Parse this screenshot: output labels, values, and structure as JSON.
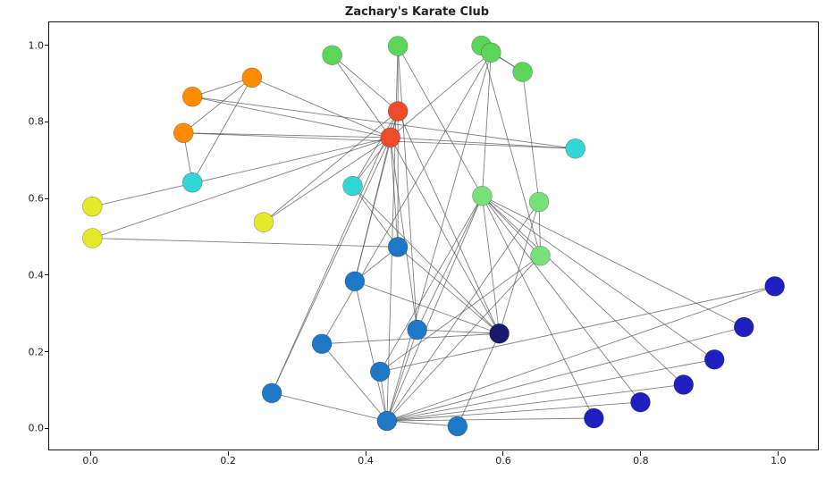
{
  "chart_data": {
    "type": "network",
    "title": "Zachary's Karate Club",
    "xlabel": "",
    "ylabel": "",
    "xlim": [
      -0.06,
      1.06
    ],
    "ylim": [
      -0.06,
      1.06
    ],
    "x_ticks": [
      0.0,
      0.2,
      0.4,
      0.6,
      0.8,
      1.0
    ],
    "y_ticks": [
      0.0,
      0.2,
      0.4,
      0.6,
      0.8,
      1.0
    ],
    "nodes": [
      {
        "id": 0,
        "x": 0.437,
        "y": 0.758,
        "color": "#ee4b2b"
      },
      {
        "id": 1,
        "x": 0.448,
        "y": 0.827,
        "color": "#ee4b2b"
      },
      {
        "id": 2,
        "x": 0.596,
        "y": 0.244,
        "color": "#191970"
      },
      {
        "id": 3,
        "x": 0.448,
        "y": 0.471,
        "color": "#1e78c8"
      },
      {
        "id": 4,
        "x": 0.148,
        "y": 0.865,
        "color": "#ff8c00"
      },
      {
        "id": 5,
        "x": 0.135,
        "y": 0.77,
        "color": "#ff8c00"
      },
      {
        "id": 6,
        "x": 0.235,
        "y": 0.915,
        "color": "#ff8c00"
      },
      {
        "id": 7,
        "x": 0.382,
        "y": 0.631,
        "color": "#33d6d6"
      },
      {
        "id": 8,
        "x": 0.476,
        "y": 0.254,
        "color": "#1e78c8"
      },
      {
        "id": 9,
        "x": 0.535,
        "y": 0.001,
        "color": "#1e78c8"
      },
      {
        "id": 10,
        "x": 0.707,
        "y": 0.729,
        "color": "#33d6d6"
      },
      {
        "id": 11,
        "x": 0.002,
        "y": 0.577,
        "color": "#e8e82a"
      },
      {
        "id": 12,
        "x": 0.002,
        "y": 0.494,
        "color": "#e8e82a"
      },
      {
        "id": 13,
        "x": 0.385,
        "y": 0.381,
        "color": "#1e78c8"
      },
      {
        "id": 14,
        "x": 0.734,
        "y": 0.022,
        "color": "#2020c0"
      },
      {
        "id": 15,
        "x": 0.802,
        "y": 0.064,
        "color": "#2020c0"
      },
      {
        "id": 16,
        "x": 0.148,
        "y": 0.64,
        "color": "#33d6d6"
      },
      {
        "id": 17,
        "x": 0.252,
        "y": 0.536,
        "color": "#e8e82a"
      },
      {
        "id": 18,
        "x": 0.865,
        "y": 0.11,
        "color": "#2020c0"
      },
      {
        "id": 19,
        "x": 0.264,
        "y": 0.088,
        "color": "#1e78c8"
      },
      {
        "id": 20,
        "x": 0.91,
        "y": 0.176,
        "color": "#2020c0"
      },
      {
        "id": 21,
        "x": 0.352,
        "y": 0.974,
        "color": "#5bd65b"
      },
      {
        "id": 22,
        "x": 0.953,
        "y": 0.261,
        "color": "#2020c0"
      },
      {
        "id": 23,
        "x": 0.656,
        "y": 0.448,
        "color": "#78e078"
      },
      {
        "id": 24,
        "x": 0.63,
        "y": 0.93,
        "color": "#5bd65b"
      },
      {
        "id": 25,
        "x": 0.57,
        "y": 0.999,
        "color": "#5bd65b"
      },
      {
        "id": 26,
        "x": 0.998,
        "y": 0.368,
        "color": "#2020c0"
      },
      {
        "id": 27,
        "x": 0.654,
        "y": 0.589,
        "color": "#78e078"
      },
      {
        "id": 28,
        "x": 0.337,
        "y": 0.217,
        "color": "#1e78c8"
      },
      {
        "id": 29,
        "x": 0.422,
        "y": 0.144,
        "color": "#1e78c8"
      },
      {
        "id": 30,
        "x": 0.448,
        "y": 0.998,
        "color": "#5bd65b"
      },
      {
        "id": 31,
        "x": 0.584,
        "y": 0.981,
        "color": "#5bd65b"
      },
      {
        "id": 32,
        "x": 0.571,
        "y": 0.605,
        "color": "#78e078"
      },
      {
        "id": 33,
        "x": 0.432,
        "y": 0.015,
        "color": "#1e78c8"
      }
    ],
    "edges": [
      [
        0,
        1
      ],
      [
        0,
        2
      ],
      [
        0,
        3
      ],
      [
        0,
        4
      ],
      [
        0,
        5
      ],
      [
        0,
        6
      ],
      [
        0,
        7
      ],
      [
        0,
        8
      ],
      [
        0,
        10
      ],
      [
        0,
        11
      ],
      [
        0,
        12
      ],
      [
        0,
        13
      ],
      [
        0,
        17
      ],
      [
        0,
        19
      ],
      [
        0,
        21
      ],
      [
        0,
        31
      ],
      [
        1,
        2
      ],
      [
        1,
        3
      ],
      [
        1,
        7
      ],
      [
        1,
        13
      ],
      [
        1,
        17
      ],
      [
        1,
        19
      ],
      [
        1,
        21
      ],
      [
        1,
        30
      ],
      [
        2,
        3
      ],
      [
        2,
        7
      ],
      [
        2,
        8
      ],
      [
        2,
        9
      ],
      [
        2,
        13
      ],
      [
        2,
        27
      ],
      [
        2,
        28
      ],
      [
        2,
        32
      ],
      [
        3,
        7
      ],
      [
        3,
        12
      ],
      [
        3,
        13
      ],
      [
        4,
        6
      ],
      [
        4,
        10
      ],
      [
        5,
        6
      ],
      [
        5,
        10
      ],
      [
        5,
        16
      ],
      [
        6,
        16
      ],
      [
        8,
        30
      ],
      [
        8,
        32
      ],
      [
        8,
        33
      ],
      [
        9,
        33
      ],
      [
        13,
        33
      ],
      [
        14,
        32
      ],
      [
        14,
        33
      ],
      [
        15,
        32
      ],
      [
        15,
        33
      ],
      [
        18,
        32
      ],
      [
        18,
        33
      ],
      [
        19,
        33
      ],
      [
        20,
        32
      ],
      [
        20,
        33
      ],
      [
        22,
        32
      ],
      [
        22,
        33
      ],
      [
        23,
        25
      ],
      [
        23,
        27
      ],
      [
        23,
        29
      ],
      [
        23,
        32
      ],
      [
        23,
        33
      ],
      [
        24,
        25
      ],
      [
        24,
        27
      ],
      [
        24,
        31
      ],
      [
        25,
        31
      ],
      [
        26,
        29
      ],
      [
        26,
        33
      ],
      [
        27,
        33
      ],
      [
        28,
        31
      ],
      [
        28,
        33
      ],
      [
        29,
        32
      ],
      [
        29,
        33
      ],
      [
        30,
        32
      ],
      [
        30,
        33
      ],
      [
        31,
        32
      ],
      [
        31,
        33
      ],
      [
        32,
        33
      ]
    ]
  }
}
